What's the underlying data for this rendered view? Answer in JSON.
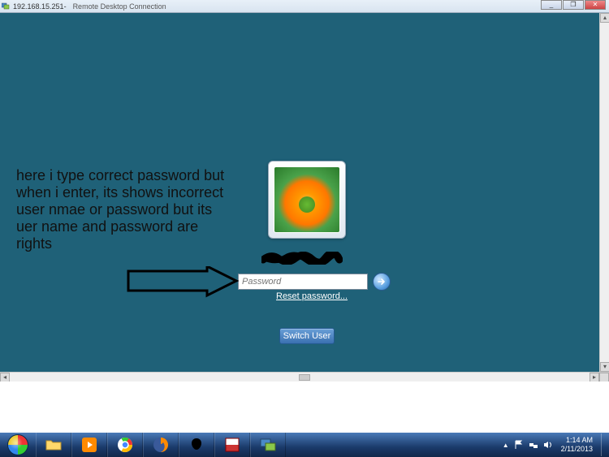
{
  "titlebar": {
    "ip": "192.168.15.251",
    "app_name": "Remote Desktop Connection",
    "min": "_",
    "max": "❐",
    "close": "✕"
  },
  "login": {
    "password_placeholder": "Password",
    "reset_link": "Reset password...",
    "switch_user": "Switch User"
  },
  "annotation": {
    "text": "here i type correct password but when i enter, its shows incorrect user nmae or password but its uer name and password are rights"
  },
  "tray": {
    "time": "1:14 AM",
    "date": "2/11/2013",
    "show_hidden": "▲"
  },
  "taskbar_items": [
    "file-explorer",
    "media-player",
    "chrome",
    "firefox",
    "unknown-app",
    "pdf-reader",
    "rdp-client"
  ]
}
